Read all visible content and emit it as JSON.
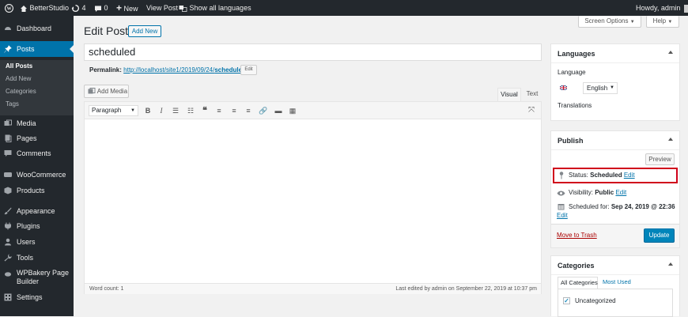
{
  "admin_bar": {
    "site_name": "BetterStudio",
    "updates_count": "4",
    "comments_count": "0",
    "new_label": "New",
    "view_post_label": "View Post",
    "languages_label": "Show all languages",
    "greeting": "Howdy, admin"
  },
  "screen_options": {
    "screen_options_label": "Screen Options",
    "help_label": "Help"
  },
  "sidebar": {
    "items": [
      {
        "label": "Dashboard"
      },
      {
        "label": "Posts"
      },
      {
        "label": "Media"
      },
      {
        "label": "Pages"
      },
      {
        "label": "Comments"
      },
      {
        "label": "WooCommerce"
      },
      {
        "label": "Products"
      },
      {
        "label": "Appearance"
      },
      {
        "label": "Plugins"
      },
      {
        "label": "Users"
      },
      {
        "label": "Tools"
      },
      {
        "label": "WPBakery Page Builder"
      },
      {
        "label": "Settings"
      }
    ],
    "submenu": [
      "All Posts",
      "Add New",
      "Categories",
      "Tags"
    ]
  },
  "page": {
    "title": "Edit Post",
    "add_new_label": "Add New",
    "post_title": "scheduled",
    "permalink_label": "Permalink:",
    "permalink_url_base": "http://localhost/site1/2019/09/24/",
    "permalink_slug": "scheduled",
    "permalink_url_end": "/",
    "permalink_edit_label": "Edit"
  },
  "editor": {
    "add_media_label": "Add Media",
    "tab_visual": "Visual",
    "tab_text": "Text",
    "format_select": "Paragraph",
    "word_count": "Word count: 1",
    "last_edited": "Last edited by admin on September 22, 2019 at 10:37 pm"
  },
  "languages_box": {
    "title": "Languages",
    "language_label": "Language",
    "selected_language": "English",
    "translations_label": "Translations"
  },
  "publish_box": {
    "title": "Publish",
    "preview_label": "Preview",
    "status_label": "Status:",
    "status_value": "Scheduled",
    "status_edit": "Edit",
    "visibility_label": "Visibility:",
    "visibility_value": "Public",
    "visibility_edit": "Edit",
    "scheduled_label": "Scheduled for:",
    "scheduled_value": "Sep 24, 2019 @ 22:36",
    "scheduled_edit": "Edit",
    "trash_label": "Move to Trash",
    "update_label": "Update",
    "highlight_color": "#d0021b"
  },
  "categories_box": {
    "title": "Categories",
    "tab_all": "All Categories",
    "tab_most_used": "Most Used",
    "items": [
      {
        "label": "Uncategorized",
        "checked": true
      }
    ]
  },
  "colors": {
    "admin_bar": "#23282d",
    "accent": "#0073aa",
    "primary_button": "#0085ba",
    "trash": "#a00"
  }
}
